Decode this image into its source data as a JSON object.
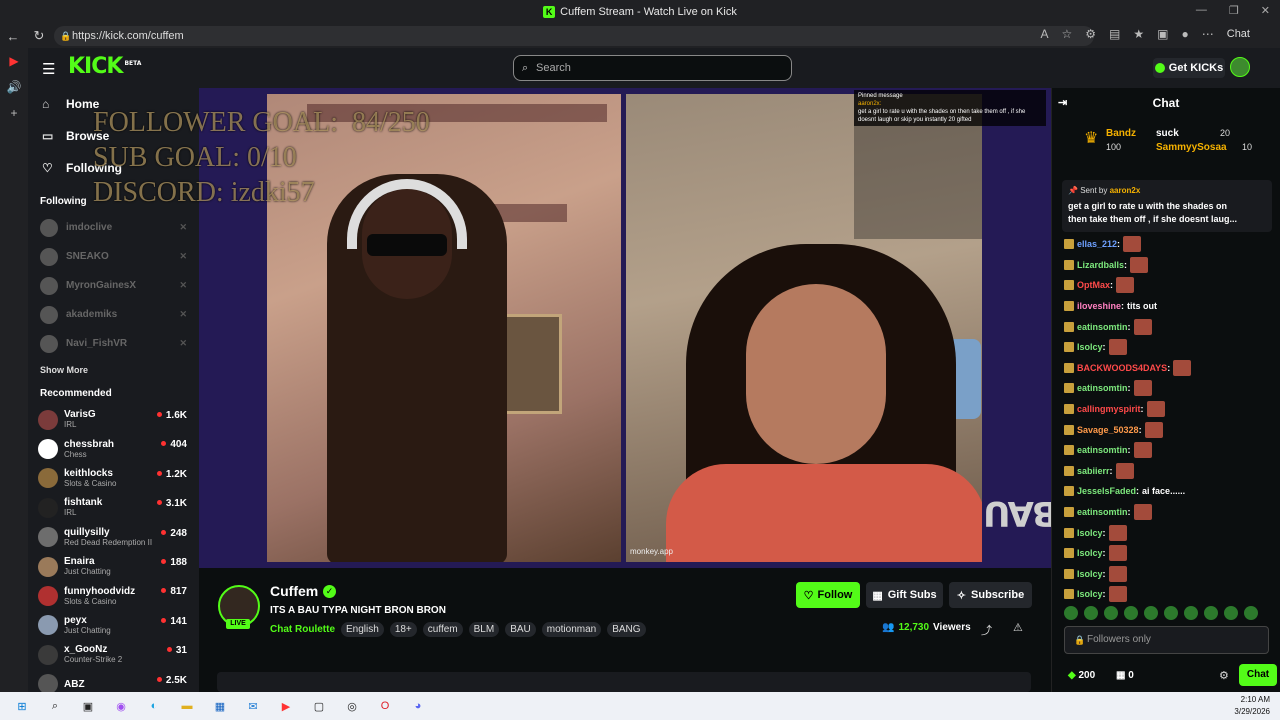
{
  "browser": {
    "title": "Cuffem Stream - Watch Live on Kick",
    "url": "https://kick.com/cuffem",
    "chat_label": "Chat"
  },
  "header": {
    "logo": "KICK",
    "logo_badge": "BETA",
    "search_placeholder": "Search",
    "get_kicks": "Get KICKs"
  },
  "sidebar": {
    "nav": [
      {
        "label": "Home",
        "icon": "home-icon"
      },
      {
        "label": "Browse",
        "icon": "browse-icon"
      },
      {
        "label": "Following",
        "icon": "heart-icon"
      }
    ],
    "following_title": "Following",
    "following": [
      "imdoclive",
      "SNEAKO",
      "MyronGainesX",
      "akademiks",
      "Navi_FishVR"
    ],
    "show_more": "Show More",
    "recommended_title": "Recommended",
    "recommended": [
      {
        "name": "VarisG",
        "category": "IRL",
        "viewers": "1.6K",
        "color": "#7b3b3b"
      },
      {
        "name": "chessbrah",
        "category": "Chess",
        "viewers": "404",
        "color": "#ffffff"
      },
      {
        "name": "keithlocks",
        "category": "Slots & Casino",
        "viewers": "1.2K",
        "color": "#8a6a3a"
      },
      {
        "name": "fishtank",
        "category": "IRL",
        "viewers": "3.1K",
        "color": "#222222"
      },
      {
        "name": "quillysilly",
        "category": "Red Dead Redemption II",
        "viewers": "248",
        "color": "#6d6d6d"
      },
      {
        "name": "Enaira",
        "category": "Just Chatting",
        "viewers": "188",
        "color": "#9a7a5a"
      },
      {
        "name": "funnyhoodvidz",
        "category": "Slots & Casino",
        "viewers": "817",
        "color": "#b03030"
      },
      {
        "name": "peyx",
        "category": "Just Chatting",
        "viewers": "141",
        "color": "#8a9ab0"
      },
      {
        "name": "x_GooNz",
        "category": "Counter-Strike 2",
        "viewers": "31",
        "color": "#3a3a3a"
      },
      {
        "name": "ABZ",
        "category": "",
        "viewers": "2.5K",
        "color": "#555555"
      }
    ]
  },
  "video": {
    "overlay_lines": [
      "FOLLOWER GOAL:  84/250",
      "SUB GOAL: 0/10",
      "DISCORD: izdki57"
    ],
    "cam_right_tag": "monkey.app",
    "pinned_overlay_title": "Pinned message",
    "pinned_overlay_user": "aaron2x:",
    "pinned_overlay_text": "get a girl to rate u with the shades on then take them off , if she doesnt laugh or skip you instantly 20 gifted",
    "bau_logo": "BAU"
  },
  "channel": {
    "name": "Cuffem",
    "live": "LIVE",
    "stream_title": "ITS A BAU TYPA NIGHT BRON BRON",
    "category": "Chat Roulette",
    "tags": [
      "English",
      "18+",
      "cuffem",
      "BLM",
      "BAU",
      "motionman",
      "BANG"
    ],
    "follow_label": "Follow",
    "gift_label": "Gift Subs",
    "subscribe_label": "Subscribe",
    "viewers_count": "12,730",
    "viewers_label": "Viewers"
  },
  "chat": {
    "title": "Chat",
    "leaderboard": [
      {
        "name": "Bandz",
        "amount_a": "100",
        "amount_b": ""
      },
      {
        "name": "suck",
        "amount_a": "20",
        "amount_b": ""
      },
      {
        "name": "SammyySosaa",
        "amount_a": "10",
        "amount_b": ""
      }
    ],
    "pinned_sent_by": "Sent by",
    "pinned_user": "aaron2x",
    "pinned_text": "get a girl to rate u with the shades on\nthen take them off , if she doesnt laug...",
    "messages": [
      {
        "user": "ellas_212",
        "color": "#6ea0ff",
        "text": "",
        "emote": true
      },
      {
        "user": "Lizardballs",
        "color": "#7de87d",
        "text": "",
        "emote": true
      },
      {
        "user": "OptMax",
        "color": "#ff4a4a",
        "text": "",
        "emote": true
      },
      {
        "user": "iloveshine",
        "color": "#ff80c0",
        "text": "tits out",
        "emote": false
      },
      {
        "user": "eatinsomtin",
        "color": "#7de87d",
        "text": "",
        "emote": true
      },
      {
        "user": "Isolcy",
        "color": "#7de87d",
        "text": "",
        "emote": true
      },
      {
        "user": "BACKWOODS4DAYS",
        "color": "#ff4a4a",
        "text": "",
        "emote": true
      },
      {
        "user": "eatinsomtin",
        "color": "#7de87d",
        "text": "",
        "emote": true
      },
      {
        "user": "callingmyspirit",
        "color": "#ff4a4a",
        "text": "",
        "emote": true
      },
      {
        "user": "Savage_50328",
        "color": "#ff9a4a",
        "text": "",
        "emote": true
      },
      {
        "user": "eatinsomtin",
        "color": "#7de87d",
        "text": "",
        "emote": true
      },
      {
        "user": "sabiierr",
        "color": "#7de87d",
        "text": "",
        "emote": true
      },
      {
        "user": "JesselsFaded",
        "color": "#7de87d",
        "text": "ai face......",
        "emote": false
      },
      {
        "user": "eatinsomtin",
        "color": "#7de87d",
        "text": "",
        "emote": true
      },
      {
        "user": "Isolcy",
        "color": "#7de87d",
        "text": "",
        "emote": true
      },
      {
        "user": "Isolcy",
        "color": "#7de87d",
        "text": "",
        "emote": true
      },
      {
        "user": "Isolcy",
        "color": "#7de87d",
        "text": "",
        "emote": true
      },
      {
        "user": "Isolcy",
        "color": "#7de87d",
        "text": "",
        "emote": true
      }
    ],
    "input_placeholder": "Followers only",
    "kick_points": "200",
    "gift_count": "0",
    "send_label": "Chat"
  },
  "taskbar": {
    "time": "2:10 AM",
    "date": "3/29/2026"
  },
  "colors": {
    "brand": "#53fc18",
    "background": "#0b0e0f",
    "panel": "#191b1f"
  }
}
